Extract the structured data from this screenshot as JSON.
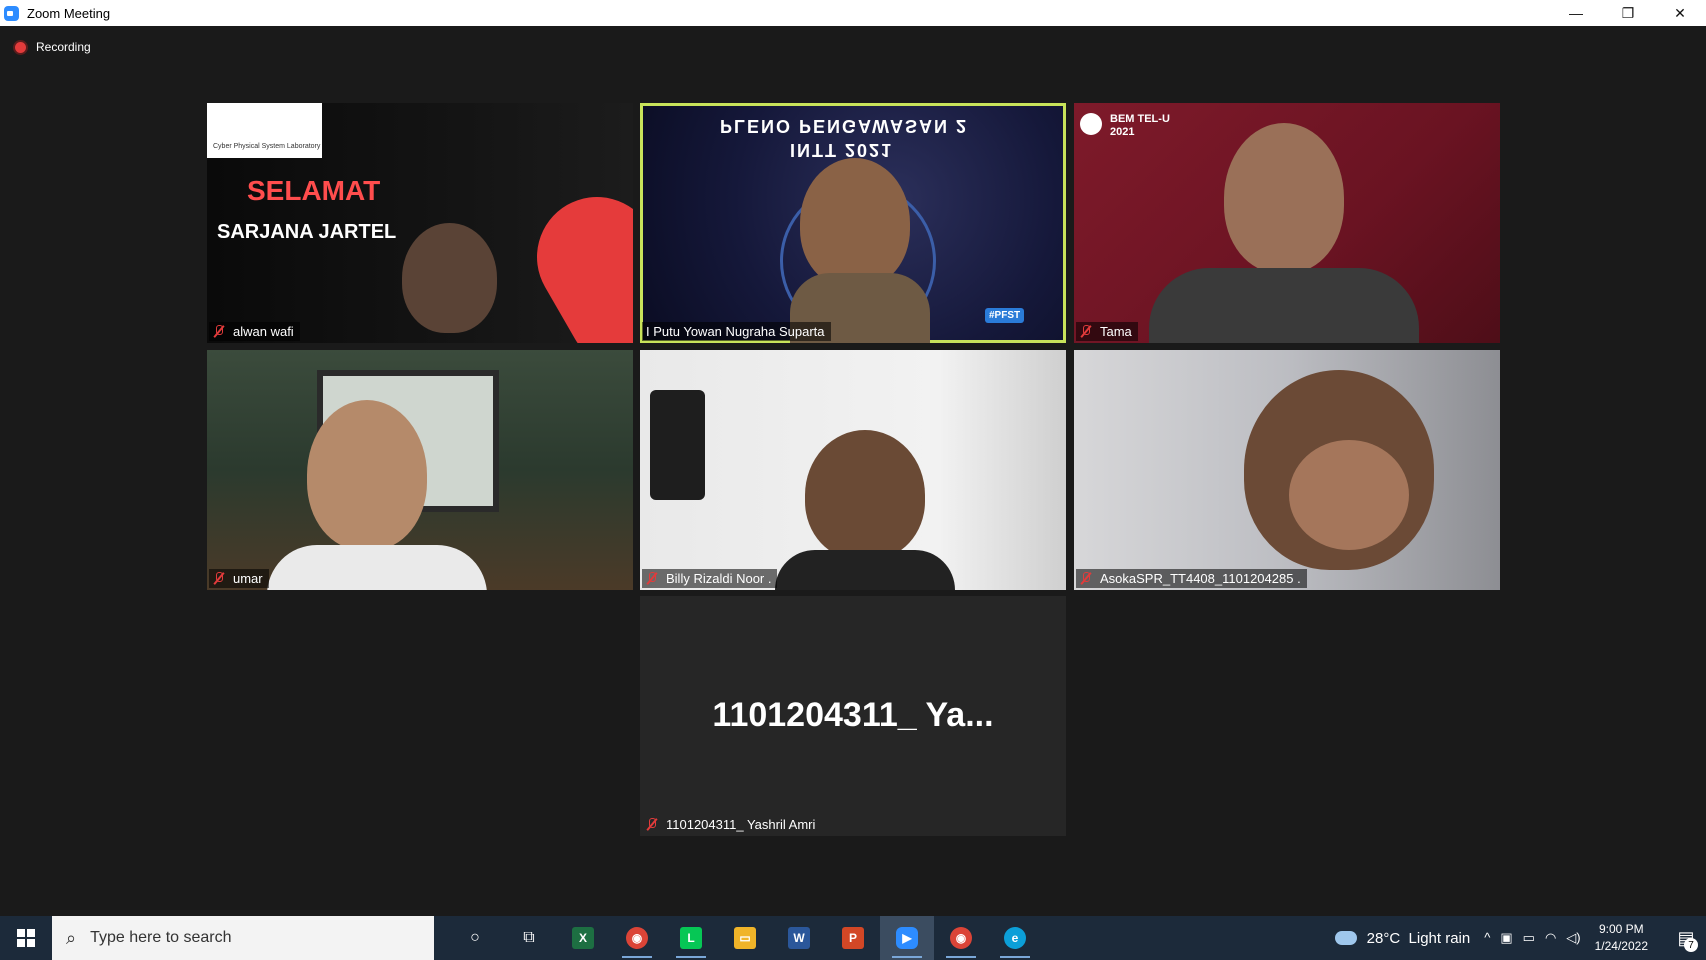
{
  "window": {
    "title": "Zoom Meeting",
    "controls": {
      "minimize": "—",
      "restore": "❐",
      "close": "✕"
    }
  },
  "meeting": {
    "recording_label": "Recording",
    "active_speaker_color": "#c8e35a",
    "participants": [
      {
        "name": "alwan wafi",
        "muted": true
      },
      {
        "name": "I Putu Yowan Nugraha Suparta",
        "muted": false,
        "active": true
      },
      {
        "name": "Tama",
        "muted": true
      },
      {
        "name": "umar",
        "muted": true
      },
      {
        "name": "Billy Rizaldi Noor .",
        "muted": true
      },
      {
        "name": "AsokaSPR_TT4408_1101204285 .",
        "muted": true
      },
      {
        "name": "1101204311_ Yashril Amri",
        "muted": true,
        "video_off": true,
        "display_label": "1101204311_ Ya..."
      }
    ],
    "backgrounds": {
      "alwan": {
        "headline": "SELAMAT",
        "subline": "SARJANA JARTEL",
        "lab": "Cyber Physical System Laboratory"
      },
      "putu": {
        "headline": "PLENO PENGAWASAN 2",
        "subline": "INTT 2021",
        "badge": "#PFST"
      },
      "tama": {
        "badge_line1": "BEM TEL-U",
        "badge_line2": "2021"
      }
    }
  },
  "taskbar": {
    "search_placeholder": "Type here to search",
    "apps": [
      {
        "name": "cortana",
        "glyph": "○"
      },
      {
        "name": "task-view",
        "glyph": "⧉"
      },
      {
        "name": "excel",
        "glyph": "X",
        "color": "#1d6f42"
      },
      {
        "name": "chrome",
        "glyph": "◉",
        "color": "#db4437"
      },
      {
        "name": "line",
        "glyph": "L",
        "color": "#06c755"
      },
      {
        "name": "file-explorer",
        "glyph": "▭",
        "color": "#f0b429"
      },
      {
        "name": "word",
        "glyph": "W",
        "color": "#2b579a"
      },
      {
        "name": "powerpoint",
        "glyph": "P",
        "color": "#d24726"
      },
      {
        "name": "zoom",
        "glyph": "▶",
        "color": "#2d8cff"
      },
      {
        "name": "chrome-profile",
        "glyph": "◉",
        "color": "#db4437"
      },
      {
        "name": "edge",
        "glyph": "e",
        "color": "#0c9fd8"
      }
    ],
    "weather": {
      "temp": "28°C",
      "condition": "Light rain"
    },
    "clock": {
      "time": "9:00 PM",
      "date": "1/24/2022"
    },
    "notifications": "7"
  }
}
